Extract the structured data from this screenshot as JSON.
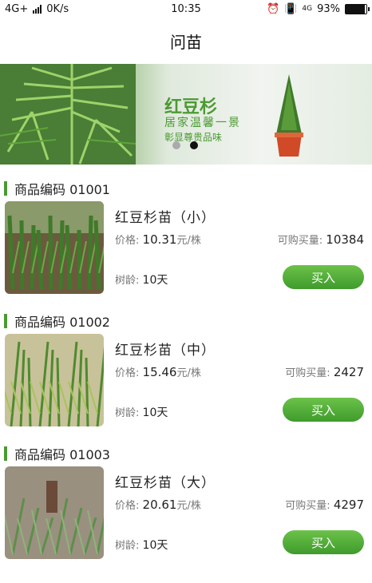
{
  "status_bar": {
    "network": "4G+",
    "speed": "0K/s",
    "time": "10:35",
    "network2": "4G",
    "battery_text": "93%",
    "battery_level": 0.93
  },
  "header": {
    "title": "问苗"
  },
  "banner": {
    "title": "红豆杉",
    "line1": "居家温馨一景",
    "line2": "彰显尊贵品味",
    "slides": 2,
    "active_slide": 2
  },
  "labels": {
    "price": "价格:",
    "unit": "元/株",
    "qty": "可购买量:",
    "age": "树龄:",
    "buy": "买入"
  },
  "products": [
    {
      "code": "商品编码 01001",
      "name": "红豆杉苗（小）",
      "price": "10.31",
      "quantity": "10384",
      "age": "10天"
    },
    {
      "code": "商品编码 01002",
      "name": "红豆杉苗（中）",
      "price": "15.46",
      "quantity": "2427",
      "age": "10天"
    },
    {
      "code": "商品编码 01003",
      "name": "红豆杉苗（大）",
      "price": "20.61",
      "quantity": "4297",
      "age": "10天"
    }
  ]
}
